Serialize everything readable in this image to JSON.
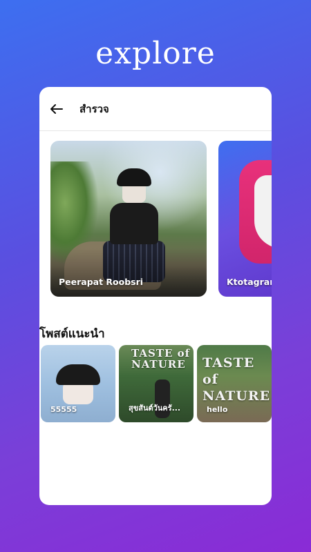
{
  "hero": {
    "title": "explore"
  },
  "header": {
    "title": "สำรวจ"
  },
  "featured": [
    {
      "label": "Peerapat Roobsri"
    },
    {
      "label": "Ktotagram"
    }
  ],
  "recommended": {
    "title": "โพสต์แนะนำ",
    "posts": [
      {
        "label": "55555"
      },
      {
        "label": "สุขสันต์วันครั..."
      },
      {
        "label": "hello"
      }
    ]
  },
  "signs": {
    "taste_of_nature": "TASTE of NATURE"
  },
  "colors": {
    "background_start": "#3d6ff0",
    "background_end": "#8a2bd6",
    "brand_pink": "#e8317b"
  }
}
